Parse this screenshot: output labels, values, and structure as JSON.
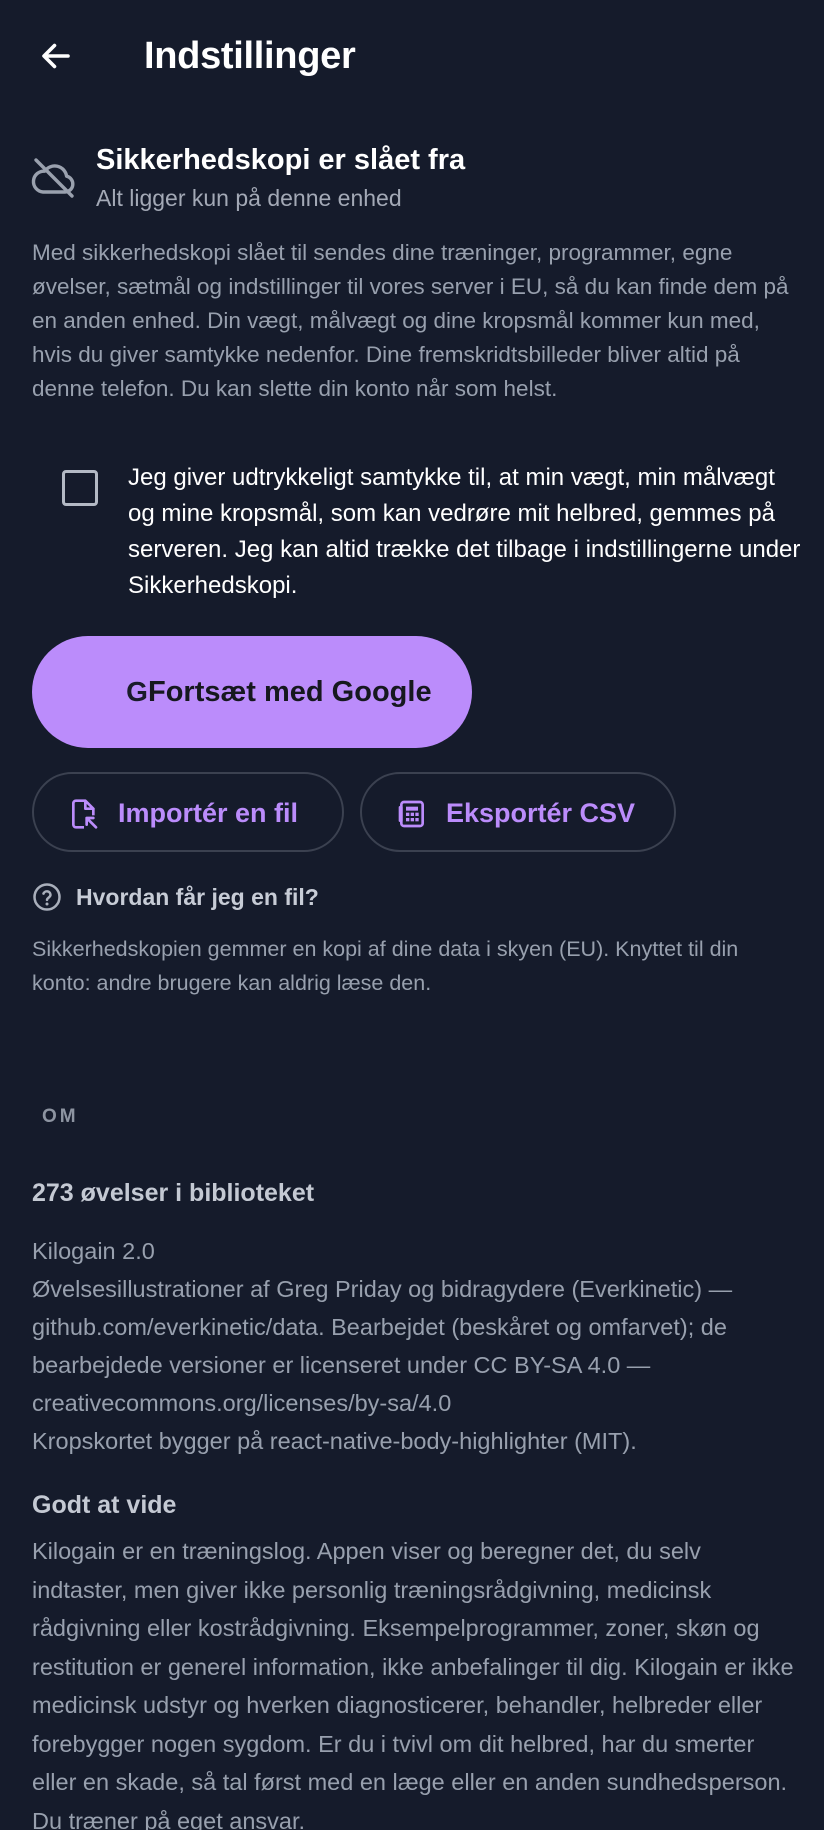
{
  "header": {
    "title": "Indstillinger",
    "back_icon": "arrow-left-icon"
  },
  "backup": {
    "icon": "cloud-off-icon",
    "title": "Sikkerhedskopi er slået fra",
    "subtitle": "Alt ligger kun på denne enhed",
    "description": "Med sikkerhedskopi slået til sendes dine træninger, programmer, egne øvelser, sætmål og indstillinger til vores server i EU, så du kan finde dem på en anden enhed. Din vægt, målvægt og dine kropsmål kommer kun med, hvis du giver samtykke nedenfor. Dine fremskridtsbilleder bliver altid på denne telefon. Du kan slette din konto når som helst."
  },
  "consent": {
    "checked": false,
    "text": "Jeg giver udtrykkeligt samtykke til, at min vægt, min målvægt og mine kropsmål, som kan vedrøre mit helbred, gemmes på serveren. Jeg kan altid trække det tilbage i indstillingerne under Sikkerhedskopi."
  },
  "actions": {
    "google_icon_glyph": "G",
    "google_label": "Fortsæt med Google",
    "import_label": "Importér en fil",
    "import_icon": "file-import-icon",
    "export_label": "Eksportér CSV",
    "export_icon": "spreadsheet-icon"
  },
  "help": {
    "icon": "question-circle-icon",
    "label": "Hvordan får jeg en fil?",
    "note": "Sikkerhedskopien gemmer en kopi af dine data i skyen (EU). Knyttet til din konto: andre brugere kan aldrig læse den."
  },
  "about": {
    "section_header": "OM",
    "exercise_count": "273 øvelser i biblioteket",
    "lines": [
      "Kilogain 2.0",
      "Øvelsesillustrationer af Greg Priday og bidragydere (Everkinetic) —",
      "github.com/everkinetic/data. Bearbejdet (beskåret og omfarvet); de",
      "bearbejdede versioner er licenseret under CC BY-SA 4.0 —",
      "creativecommons.org/licenses/by-sa/4.0",
      "Kropskortet bygger på react-native-body-highlighter (MIT)."
    ],
    "good_to_know_title": "Godt at vide",
    "good_to_know_text": "Kilogain er en træningslog. Appen viser og beregner det, du selv indtaster, men giver ikke personlig træningsrådgivning, medicinsk rådgivning eller kostrådgivning. Eksempelprogrammer, zoner, skøn og restitution er generel information, ikke anbefalinger til dig. Kilogain er ikke medicinsk udstyr og hverken diagnosticerer, behandler, helbreder eller forebygger nogen sygdom. Er du i tvivl om dit helbred, har du smerter eller en skade, så tal først med en læge eller en anden sundhedsperson. Du træner på eget ansvar."
  },
  "colors": {
    "background": "#151b2b",
    "accent": "#bb8cfb",
    "muted_text": "#98a0ae"
  }
}
